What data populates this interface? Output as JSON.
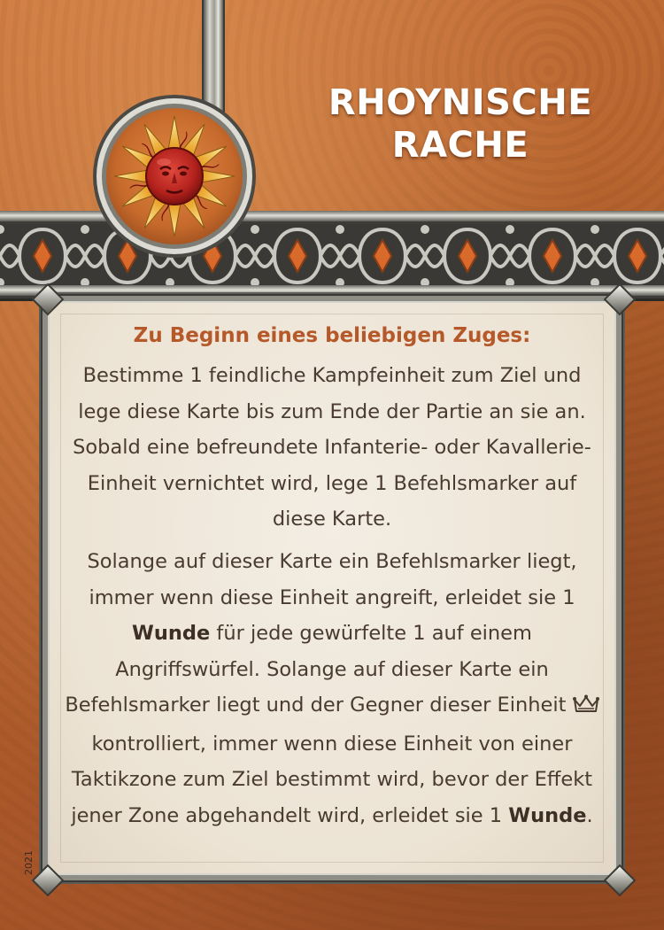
{
  "card": {
    "title_line1": "RHOYNISCHE",
    "title_line2": "RACHE",
    "heading": "Zu Beginn eines beliebigen Zuges:",
    "paragraph1": "Bestimme 1 feindliche Kampfeinheit zum Ziel und lege diese Karte bis zum Ende der Partie an sie an. Sobald eine befreundete Infanterie- oder Kavallerie-Einheit vernichtet wird, lege 1 Befehlsmarker auf diese Karte.",
    "paragraph2": {
      "part1": "Solange auf dieser Karte ein Befehlsmarker liegt, immer wenn diese Einheit angreift, erleidet sie 1 ",
      "bold1": "Wunde",
      "part2": " für jede gewürfelte 1 auf einem Angriffswürfel. Solange auf dieser Karte ein Befehlsmarker liegt und der Gegner dieser Einheit ",
      "icon": "crown-icon",
      "part3": " kontrolliert, immer wenn diese Einheit von einer Taktikzone zum Ziel bestimmt wird, bevor der Effekt jener Zone abgehandelt wird, erleidet sie 1 ",
      "bold2": "Wunde",
      "part4": "."
    },
    "year": "2021",
    "faction_icon": "sun-icon",
    "colors": {
      "background": "#b8652f",
      "heading": "#b6592a",
      "body_text": "#4a3b30",
      "title": "#ffffff",
      "parchment": "#ece3d4"
    }
  }
}
